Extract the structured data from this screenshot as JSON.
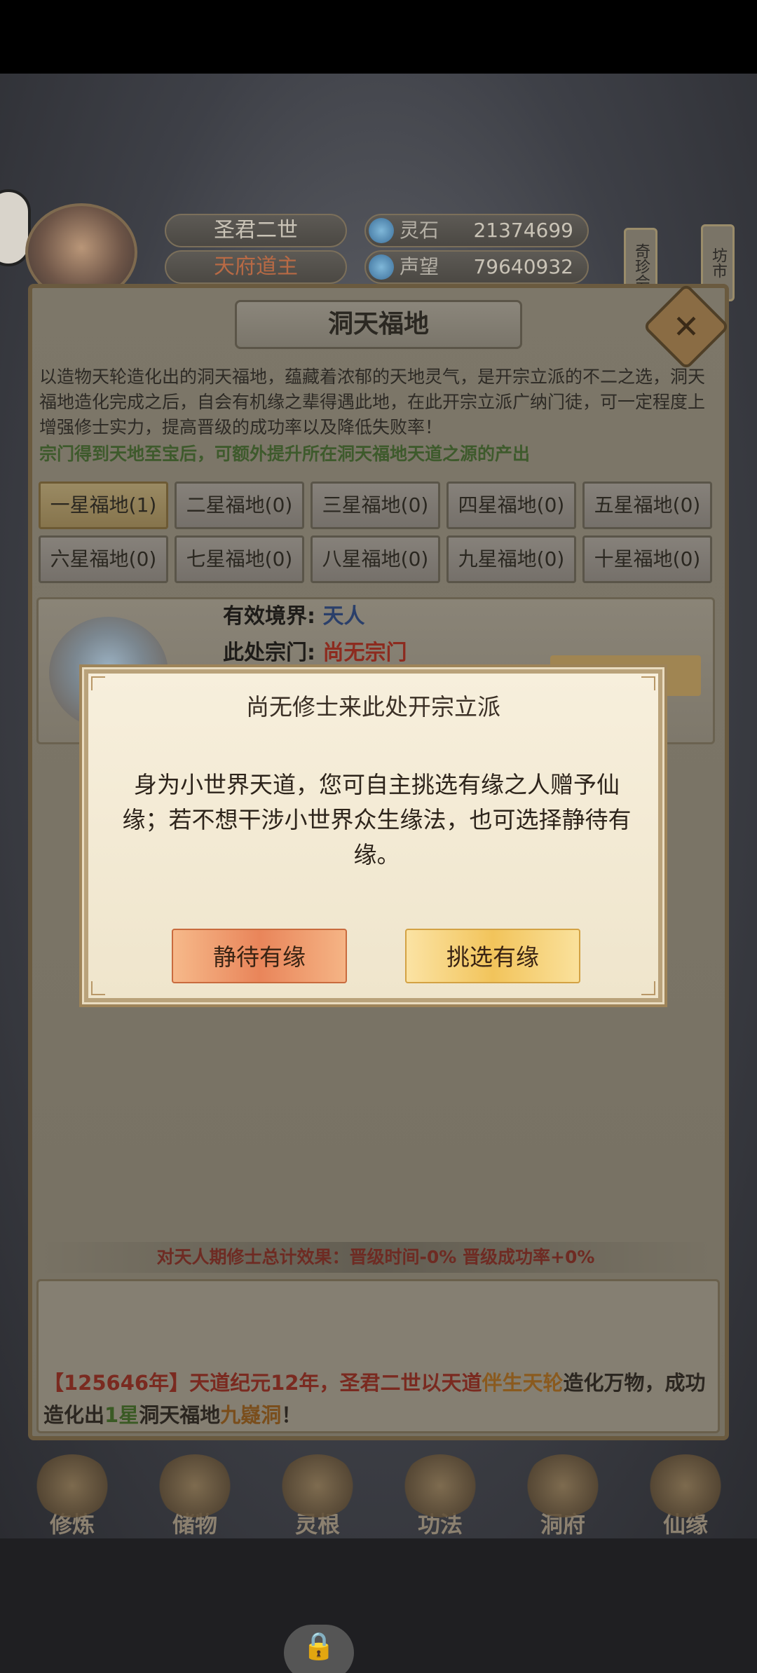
{
  "header": {
    "player_name": "圣君二世",
    "player_title": "天府道主",
    "spirit_stone_label": "灵石",
    "spirit_stone_value": "21374699",
    "fame_label": "声望",
    "fame_value": "79640932",
    "side_tag_left": "奇珍会",
    "side_tag_right": "坊市"
  },
  "panel": {
    "title": "洞天福地",
    "description": "以造物天轮造化出的洞天福地，蕴藏着浓郁的天地灵气，是开宗立派的不二之选，洞天福地造化完成之后，自会有机缘之辈得遇此地，在此开宗立派广纳门徒，可一定程度上增强修士实力，提高晋级的成功率以及降低失败率！",
    "description_highlight": "宗门得到天地至宝后，可额外提升所在洞天福地天道之源的产出",
    "tiers": [
      "一星福地(1)",
      "二星福地(0)",
      "三星福地(0)",
      "四星福地(0)",
      "五星福地(0)",
      "六星福地(0)",
      "七星福地(0)",
      "八星福地(0)",
      "九星福地(0)",
      "十星福地(0)"
    ],
    "detail": {
      "realm_label": "有效境界:",
      "realm_value": "天人",
      "sect_label": "此处宗门:",
      "sect_value": "尚无宗门"
    },
    "summary": "对天人期修士总计效果：晋级时间-0% 晋级成功率+0%",
    "log": {
      "part1": "【125646年】天道纪元12年，",
      "part2": "圣君二世",
      "part3": "以天道",
      "part4": "伴生天轮",
      "part5": "造化万物，成功造化出",
      "part6": "1星",
      "part7": "洞天福地",
      "part8": "九嶷洞",
      "part9": "！"
    }
  },
  "dialog": {
    "title": "尚无修士来此处开宗立派",
    "body": "身为小世界天道，您可自主挑选有缘之人赠予仙缘；若不想干涉小世界众生缘法，也可选择静待有缘。",
    "wait_button": "静待有缘",
    "choose_button": "挑选有缘"
  },
  "nav": [
    "修炼",
    "储物",
    "灵根",
    "功法",
    "洞府",
    "仙缘"
  ],
  "icons": {
    "close": "close-icon",
    "lock": "lock-icon"
  }
}
